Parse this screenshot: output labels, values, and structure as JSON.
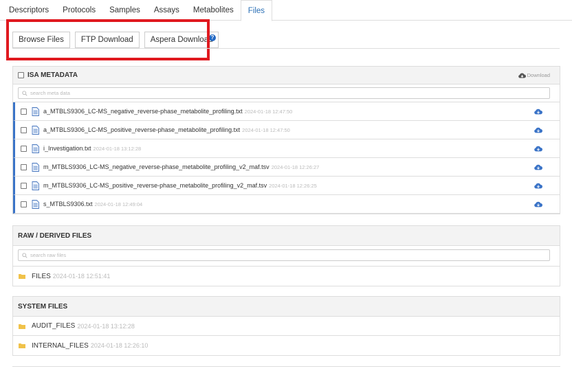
{
  "tabs": [
    {
      "label": "Descriptors",
      "active": false
    },
    {
      "label": "Protocols",
      "active": false
    },
    {
      "label": "Samples",
      "active": false
    },
    {
      "label": "Assays",
      "active": false
    },
    {
      "label": "Metabolites",
      "active": false
    },
    {
      "label": "Files",
      "active": true
    }
  ],
  "toolbar": {
    "browse_label": "Browse Files",
    "ftp_label": "FTP Download",
    "aspera_label": "Aspera Download",
    "help_glyph": "?"
  },
  "isa": {
    "title": "ISA METADATA",
    "download_label": "Download",
    "search_placeholder": "search meta data",
    "files": [
      {
        "name": "a_MTBLS9306_LC-MS_negative_reverse-phase_metabolite_profiling.txt",
        "date": "2024-01-18 12:47:50"
      },
      {
        "name": "a_MTBLS9306_LC-MS_positive_reverse-phase_metabolite_profiling.txt",
        "date": "2024-01-18 12:47:50"
      },
      {
        "name": "i_Investigation.txt",
        "date": "2024-01-18 13:12:28"
      },
      {
        "name": "m_MTBLS9306_LC-MS_negative_reverse-phase_metabolite_profiling_v2_maf.tsv",
        "date": "2024-01-18 12:26:27"
      },
      {
        "name": "m_MTBLS9306_LC-MS_positive_reverse-phase_metabolite_profiling_v2_maf.tsv",
        "date": "2024-01-18 12:26:25"
      },
      {
        "name": "s_MTBLS9306.txt",
        "date": "2024-01-18 12:49:04"
      }
    ]
  },
  "raw": {
    "title": "RAW / DERIVED FILES",
    "search_placeholder": "search raw files",
    "folders": [
      {
        "name": "FILES",
        "date": "2024-01-18 12:51:41"
      }
    ]
  },
  "system": {
    "title": "SYSTEM FILES",
    "folders": [
      {
        "name": "AUDIT_FILES",
        "date": "2024-01-18 13:12:28"
      },
      {
        "name": "INTERNAL_FILES",
        "date": "2024-01-18 12:26:10"
      }
    ]
  },
  "colors": {
    "accent": "#3a73c7",
    "highlight_box": "#e0191f",
    "folder": "#f0c24a"
  }
}
